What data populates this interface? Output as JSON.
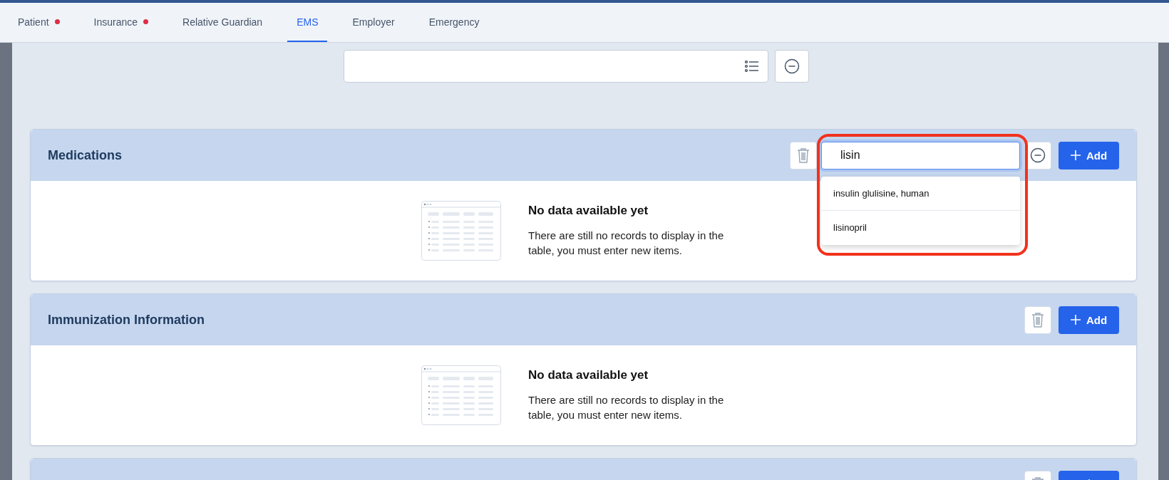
{
  "tabs": [
    {
      "label": "Patient",
      "selected": false,
      "alert": true
    },
    {
      "label": "Insurance",
      "selected": false,
      "alert": true
    },
    {
      "label": "Relative Guardian",
      "selected": false,
      "alert": false
    },
    {
      "label": "EMS",
      "selected": true,
      "alert": false
    },
    {
      "label": "Employer",
      "selected": false,
      "alert": false
    },
    {
      "label": "Emergency",
      "selected": false,
      "alert": false
    }
  ],
  "sections": [
    {
      "kind": "full",
      "title": "Medications",
      "add_label": "Add",
      "search": {
        "value": "lisin",
        "focused": true,
        "suggestions": [
          "insulin glulisine, human",
          "lisinopril"
        ]
      },
      "empty_title": "No data available yet",
      "empty_text": "There are still no records to display in the table, you must enter new items."
    },
    {
      "kind": "full",
      "title": "Immunization Information",
      "add_label": "Add",
      "empty_title": "No data available yet",
      "empty_text": "There are still no records to display in the table, you must enter new items."
    },
    {
      "kind": "cut"
    }
  ]
}
